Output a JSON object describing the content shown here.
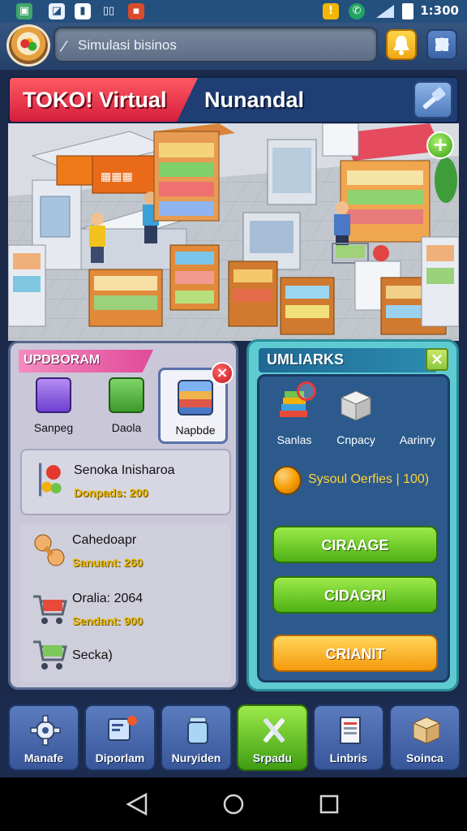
{
  "status_bar": {
    "time": "1:300"
  },
  "top_bar": {
    "search_text": "Simulasi bisinos"
  },
  "banner": {
    "title_left": "TOKO! Virtual",
    "title_right": "Nunandal"
  },
  "left_panel": {
    "header": "UPDBORAM",
    "cards": [
      {
        "label": "Sanpeg"
      },
      {
        "label": "Daola"
      },
      {
        "label": "Napbde"
      }
    ],
    "info": {
      "title": "Senoka Inisharoa",
      "subtitle": "Donpads: 200"
    },
    "list": [
      {
        "name": "Cahedoapr",
        "sub": "Sanuant: 260"
      },
      {
        "name": "Oralia: 2064",
        "sub": "Sendant: 900"
      },
      {
        "name": "Secka)",
        "sub": ""
      }
    ]
  },
  "right_panel": {
    "header": "UMLIARKS",
    "resources": [
      {
        "label": "Sanlas"
      },
      {
        "label": "Cnpacy"
      },
      {
        "label": "Aarinry"
      }
    ],
    "coins_text": "Sysoul Oerfies | 100)",
    "buttons": {
      "b1": "CIRAAGE",
      "b2": "CIDAGRI",
      "b3": "CRIANIT"
    }
  },
  "bottom_nav": [
    {
      "label": "Manafe",
      "icon": "gear-icon"
    },
    {
      "label": "Diporlam",
      "icon": "monitor-icon"
    },
    {
      "label": "Nuryiden",
      "icon": "jar-icon"
    },
    {
      "label": "Srpadu",
      "icon": "tools-icon"
    },
    {
      "label": "Linbris",
      "icon": "document-icon"
    },
    {
      "label": "Soinca",
      "icon": "box-icon"
    }
  ],
  "colors": {
    "accent_red": "#d2193a",
    "accent_green": "#4fb114",
    "accent_orange": "#f59a0c",
    "panel_teal": "#5ecbd0"
  }
}
